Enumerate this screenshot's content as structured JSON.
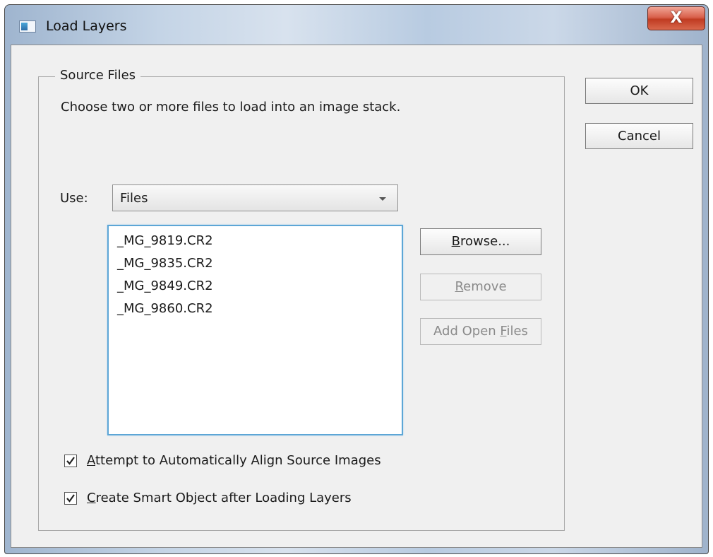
{
  "window": {
    "title": "Load Layers",
    "close_label": "X"
  },
  "source_files": {
    "legend": "Source Files",
    "description": "Choose two or more files to load into an image stack.",
    "use_label": "Use:",
    "use_value": "Files",
    "files": [
      "_MG_9819.CR2",
      "_MG_9835.CR2",
      "_MG_9849.CR2",
      "_MG_9860.CR2"
    ],
    "buttons": {
      "browse": {
        "pre": "",
        "key": "B",
        "post": "rowse..."
      },
      "remove": {
        "pre": "",
        "key": "R",
        "post": "emove"
      },
      "add_open_files": {
        "pre": "Add Open ",
        "key": "F",
        "post": "iles"
      }
    },
    "checkboxes": [
      {
        "pre": "",
        "key": "A",
        "post": "ttempt to Automatically Align Source Images",
        "checked": true
      },
      {
        "pre": "",
        "key": "C",
        "post": "reate Smart Object after Loading Layers",
        "checked": true
      }
    ]
  },
  "dialog_buttons": {
    "ok": "OK",
    "cancel": "Cancel"
  },
  "icons": {
    "app": "photoshop-window-icon",
    "close": "close-icon",
    "dropdown": "chevron-down-icon",
    "check": "check-icon"
  }
}
